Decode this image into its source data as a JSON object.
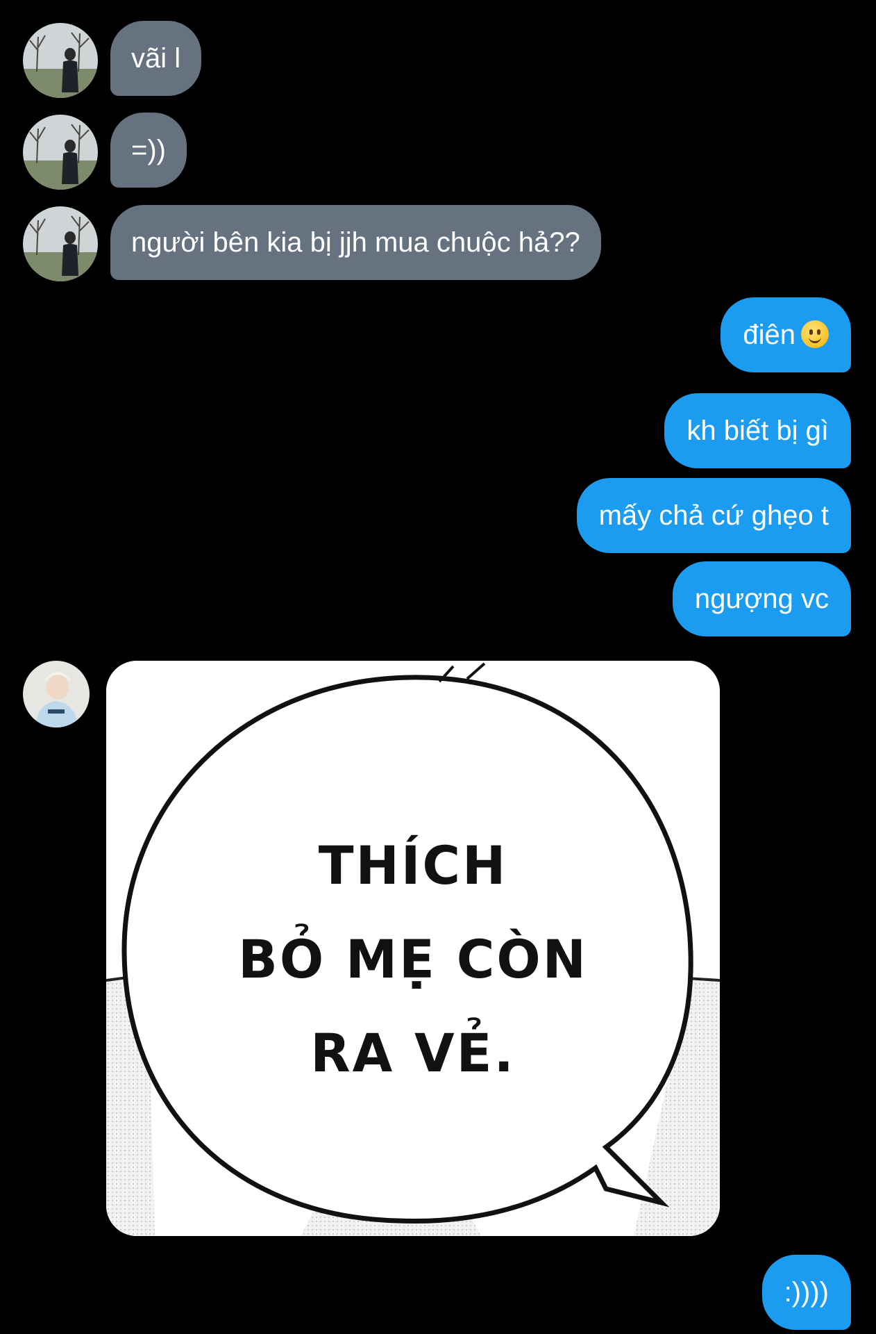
{
  "messages": [
    {
      "sender": "other",
      "text": "vãi l"
    },
    {
      "sender": "other",
      "text": "=))"
    },
    {
      "sender": "other",
      "text": "người bên kia bị jjh mua chuộc hả??"
    },
    {
      "sender": "me",
      "text": "điên",
      "emoji": "slightly-smiling-face"
    },
    {
      "sender": "me",
      "text": "kh biết bị gì"
    },
    {
      "sender": "me",
      "text": "mấy chả cứ ghẹo t"
    },
    {
      "sender": "me",
      "text": "ngượng vc"
    },
    {
      "sender": "other-2",
      "type": "image",
      "image_text": [
        "THÍCH",
        "BỎ MẸ CÒN",
        "RA VẺ."
      ]
    },
    {
      "sender": "me",
      "text": ":))))"
    }
  ],
  "colors": {
    "background": "#000000",
    "incoming_bubble": "#66727f",
    "outgoing_bubble": "#1c9cf0",
    "text": "#ffffff"
  }
}
